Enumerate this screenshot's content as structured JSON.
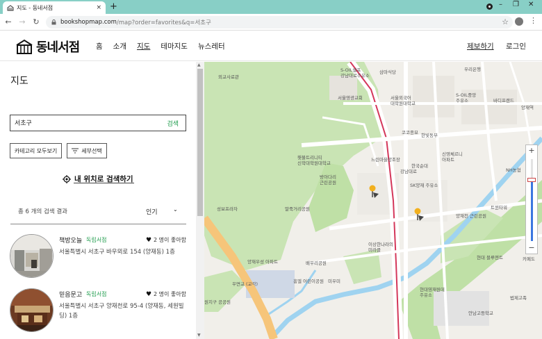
{
  "browser": {
    "tab_title": "지도 - 동네서점",
    "tab_close": "×",
    "new_tab": "+",
    "url_host": "bookshopmap.com",
    "url_path": "/map?order=favorites&q=서초구",
    "back": "←",
    "forward": "→",
    "reload": "↻",
    "bookmark": "☆",
    "menu": "⋮",
    "minimize": "–",
    "maximize": "❐",
    "close": "✕"
  },
  "site": {
    "logo_text": "동네서점",
    "nav": [
      "홈",
      "소개",
      "지도",
      "테마지도",
      "뉴스레터"
    ],
    "active_nav": "지도",
    "report": "제보하기",
    "login": "로그인"
  },
  "panel": {
    "title": "지도",
    "search_value": "서초구",
    "search_button": "검색",
    "category_button": "카테고리 모두보기",
    "filter_button": "세부선택",
    "locate_label": "내 위치로 검색하기",
    "result_count": "총 6 개의 검색 결과",
    "sort_label": "인기",
    "sort_caret": "⌄"
  },
  "shops": [
    {
      "name": "책방오늘",
      "tag": "독립서점",
      "likes": "2 명이 좋아함",
      "address": "서울특별시 서초구 바우뫼로 154 (양재동) 1층"
    },
    {
      "name": "믿음문고",
      "tag": "독립서점",
      "likes": "2 명이 좋아함",
      "address": "서울특별시 서초구 양재천로 95-4 (양재동, 세원빌딩) 1층"
    }
  ],
  "map": {
    "labels": [
      "외교사료관",
      "S-OIL셀프 강남대로주유소",
      "삼마식당",
      "우리은행",
      "서울외국어 대학원대학교",
      "서울영광교회",
      "S-OIL중앙 주유소",
      "바디프랜드",
      "양재역",
      "한빛동부",
      "코코종묘",
      "횃불트리니티 신학대학원대학교",
      "느린마을양조장",
      "강남대로",
      "한국순대",
      "신영체르니 아파트",
      "NH농협",
      "방아다리 근린공원",
      "말죽거리공원",
      "SK양재 주유소",
      "성보프라자",
      "스",
      "양재우성 아파트",
      "이상한나라의 미라클",
      "양재천 근린공원",
      "트윈타워",
      "배우리공원",
      "우면교 (교각)",
      "흥엘 어린이공원",
      "미우미",
      "현대 블루엔트",
      "카페도",
      "현대영재원데 주유소",
      "안남고등학교",
      "원지구 공공원",
      "법제고족"
    ],
    "zoom_level": 0.75,
    "zoom_in": "+",
    "zoom_out": "−"
  }
}
